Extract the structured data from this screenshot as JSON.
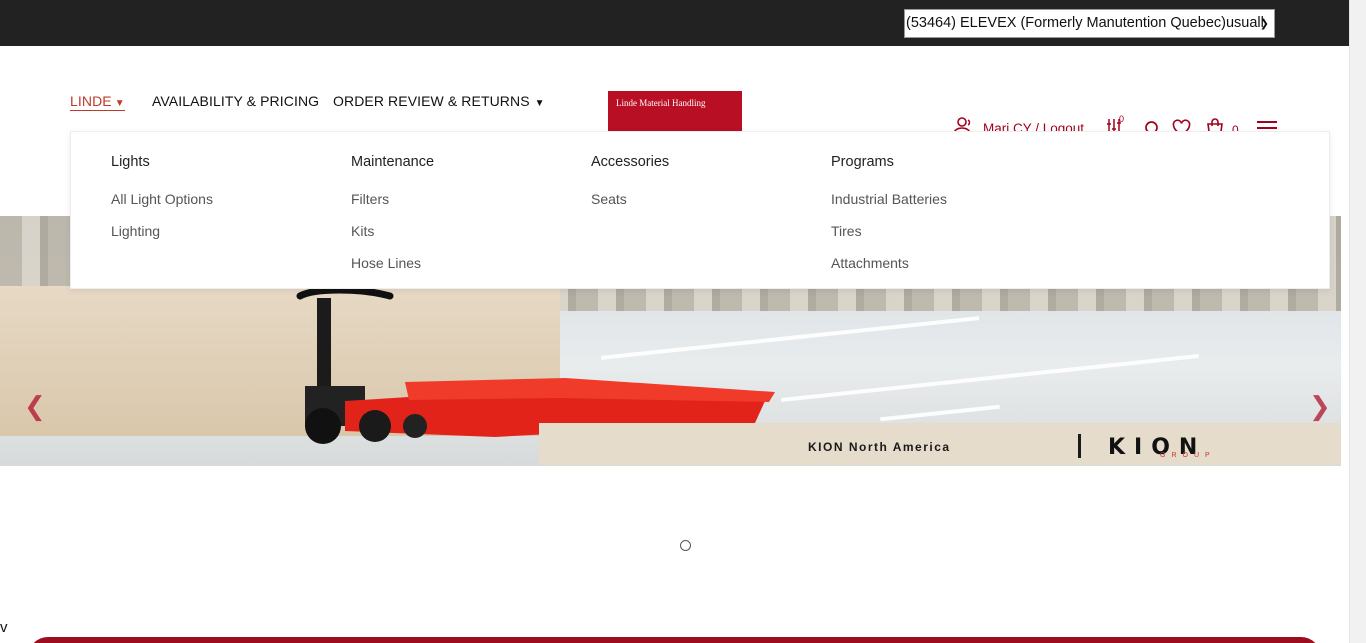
{
  "topbar": {
    "account_select": "(53464) ELEVEX (Formerly Manutention Quebec)usuall"
  },
  "nav": {
    "linde": "LINDE",
    "availability": "AVAILABILITY & PRICING",
    "order_review": "ORDER REVIEW & RETURNS"
  },
  "logo": {
    "text": "Linde Material Handling"
  },
  "user": {
    "text": "Mari CY   / Logout",
    "compare_count": "0",
    "cart_count": "0"
  },
  "mega_menu": {
    "columns": [
      {
        "heading": "Lights",
        "items": [
          "All Light Options",
          "Lighting"
        ]
      },
      {
        "heading": "Maintenance",
        "items": [
          "Filters",
          "Kits",
          "Hose Lines"
        ]
      },
      {
        "heading": "Accessories",
        "items": [
          "Seats"
        ]
      },
      {
        "heading": "Programs",
        "items": [
          "Industrial Batteries",
          "Tires",
          "Attachments"
        ]
      }
    ]
  },
  "hero": {
    "kion_na": "KION North America",
    "kion_logo": "KION",
    "kion_group": "GROUP"
  },
  "stray_text": "v",
  "colors": {
    "brand": "#b80f24",
    "accent": "#a3001e",
    "topbar": "#222222"
  }
}
